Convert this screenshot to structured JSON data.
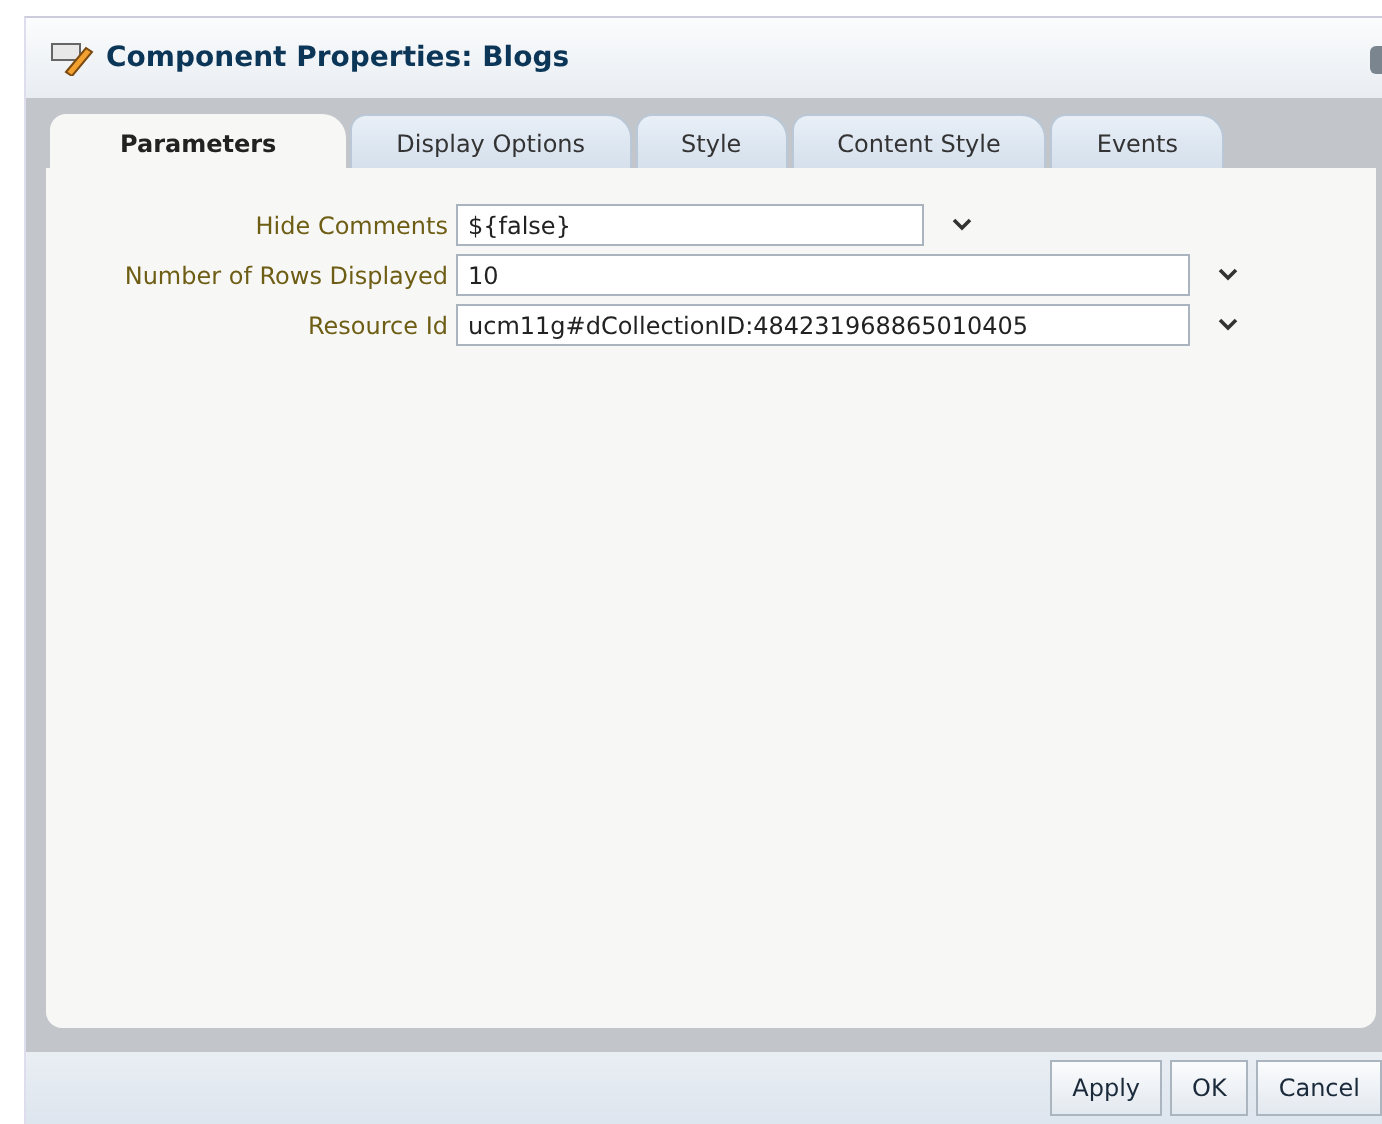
{
  "window": {
    "title": "Component Properties: Blogs"
  },
  "tabs": [
    {
      "label": "Parameters",
      "selected": true
    },
    {
      "label": "Display Options",
      "selected": false
    },
    {
      "label": "Style",
      "selected": false
    },
    {
      "label": "Content Style",
      "selected": false
    },
    {
      "label": "Events",
      "selected": false
    }
  ],
  "fields": [
    {
      "label": "Hide Comments",
      "value": "${false}",
      "kind": "short"
    },
    {
      "label": "Number of Rows Displayed",
      "value": "10",
      "kind": "long"
    },
    {
      "label": "Resource Id",
      "value": "ucm11g#dCollectionID:484231968865010405",
      "kind": "long"
    }
  ],
  "buttons": [
    "Apply",
    "OK",
    "Cancel"
  ]
}
